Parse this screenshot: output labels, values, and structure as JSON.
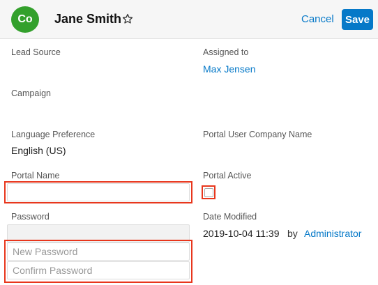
{
  "header": {
    "avatar_initials": "Co",
    "record_name": "Jane Smith",
    "cancel_label": "Cancel",
    "save_label": "Save"
  },
  "fields": {
    "lead_source": {
      "label": "Lead Source",
      "value": ""
    },
    "assigned_to": {
      "label": "Assigned to",
      "value": "Max Jensen"
    },
    "campaign": {
      "label": "Campaign",
      "value": ""
    },
    "language_preference": {
      "label": "Language Preference",
      "value": "English (US)"
    },
    "portal_user_company_name": {
      "label": "Portal User Company Name",
      "value": ""
    },
    "portal_name": {
      "label": "Portal Name",
      "value": ""
    },
    "portal_active": {
      "label": "Portal Active",
      "checked": false
    },
    "password": {
      "label": "Password",
      "value": ""
    },
    "new_password": {
      "placeholder": "New Password"
    },
    "confirm_password": {
      "placeholder": "Confirm Password"
    },
    "date_modified": {
      "label": "Date Modified",
      "date": "2019-10-04 11:39",
      "by_label": "by",
      "user": "Administrator"
    }
  },
  "colors": {
    "accent": "#0679c8",
    "avatar": "#33a02c",
    "highlight": "#e8361c"
  }
}
